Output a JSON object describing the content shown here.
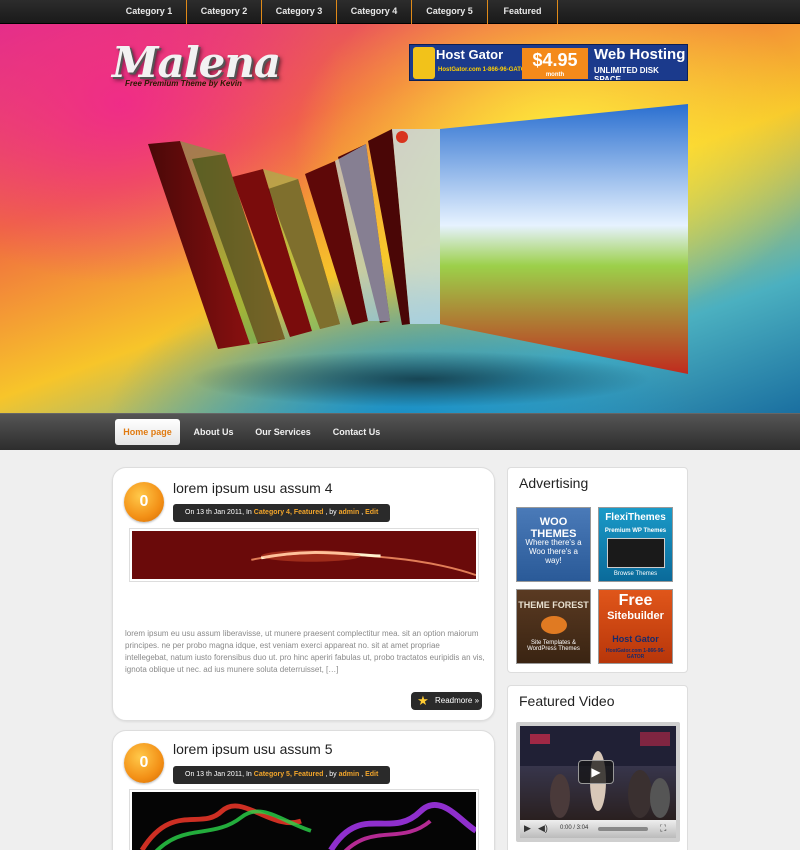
{
  "top_nav": {
    "categories": [
      "Category 1",
      "Category 2",
      "Category 3",
      "Category 4",
      "Category 5",
      "Featured"
    ]
  },
  "header": {
    "logo": "Malena",
    "tagline": "Free Premium Theme by Kevin",
    "banner_ad": {
      "brand": "Host Gator",
      "phone": "HostGator.com 1-866-96-GATOR",
      "price": "$4.95",
      "price_unit": "month",
      "headline": "Web Hosting",
      "subline": "UNLIMITED DISK SPACE"
    }
  },
  "main_nav": {
    "items": [
      "Home page",
      "About Us",
      "Our Services",
      "Contact Us"
    ],
    "active_index": 0
  },
  "posts": [
    {
      "comments": "0",
      "title": "lorem ipsum usu assum 4",
      "meta_prefix": "On 13 th Jan 2011, In",
      "categories": "Category 4, Featured",
      "by": ", by",
      "author": "admin",
      "edit": "Edit",
      "excerpt": "lorem ipsum eu usu assum liberavisse, ut munere praesent complectitur mea. sit an option maiorum principes. ne per probo magna idque, est veniam exerci appareat no. sit at amet propriae intellegebat, natum iusto forensibus duo ut. pro hinc aperiri fabulas ut, probo tractatos euripidis an vis, ignota oblique ut nec. ad ius munere soluta deterruisset, […]",
      "readmore": "Readmore »"
    },
    {
      "comments": "0",
      "title": "lorem ipsum usu assum 5",
      "meta_prefix": "On 13 th Jan 2011, In",
      "categories": "Category 5, Featured",
      "by": ", by",
      "author": "admin",
      "edit": "Edit"
    }
  ],
  "sidebar": {
    "advertising": {
      "title": "Advertising",
      "ads": [
        {
          "name": "WooThemes",
          "line1": "WOO THEMES",
          "line2": "Where there's a Woo there's a way!"
        },
        {
          "name": "FlexiThemes",
          "line1": "FlexiThemes",
          "line2": "Premium WP Themes",
          "line3": "Browse Themes"
        },
        {
          "name": "ThemeForest",
          "line1": "THEME FOREST",
          "line2": "Site Templates & WordPress Themes"
        },
        {
          "name": "HostGator",
          "line1": "Free",
          "line2": "Sitebuilder",
          "line3": "Host Gator",
          "line4": "HostGator.com 1-866-96-GATOR"
        }
      ]
    },
    "video": {
      "title": "Featured Video",
      "time": "0:00 / 3:04"
    }
  },
  "colors": {
    "accent": "#f39016",
    "topbar": "#222222",
    "nav": "#3a3a3a"
  }
}
